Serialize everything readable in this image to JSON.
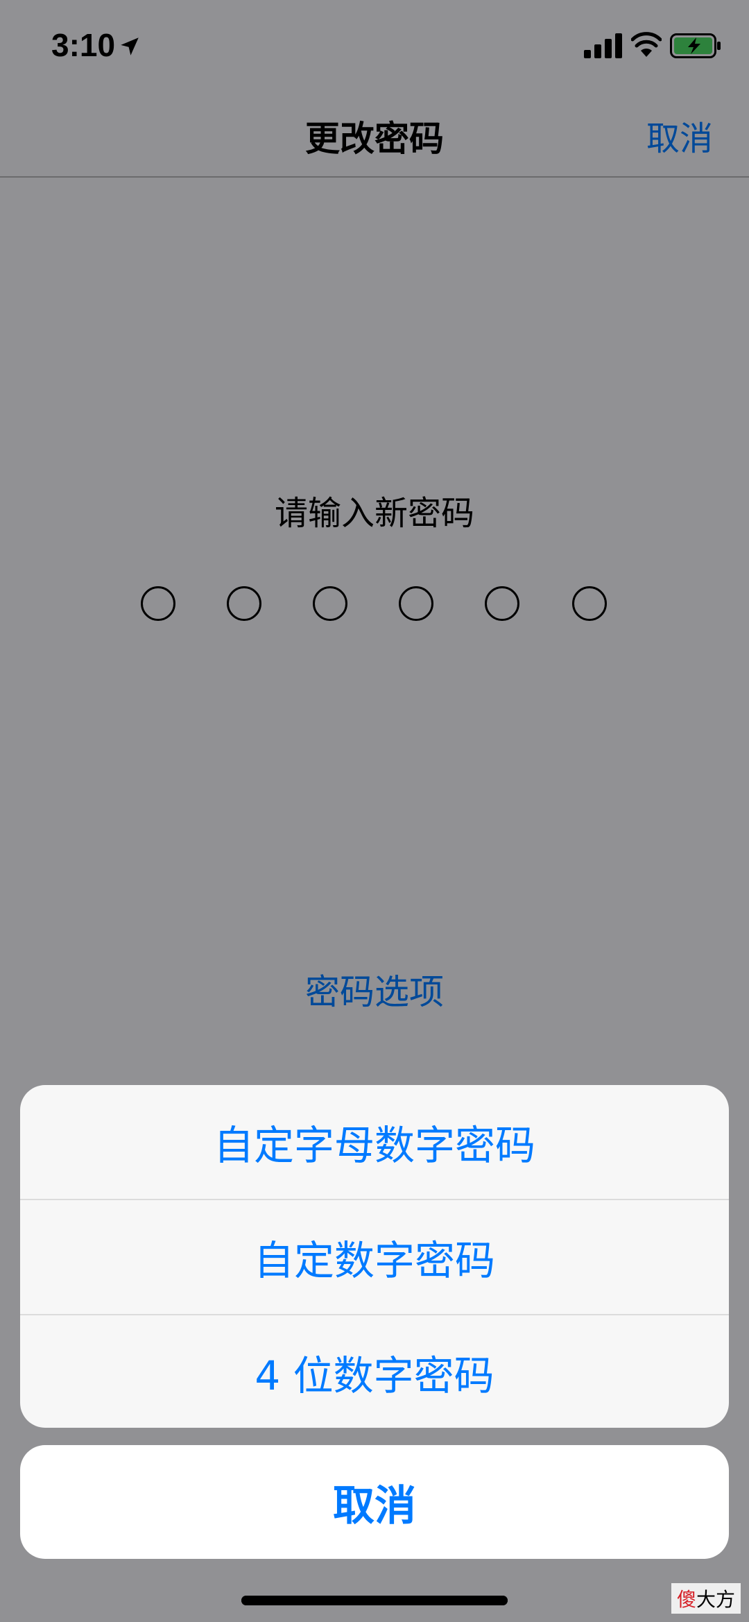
{
  "status_bar": {
    "time": "3:10",
    "icons": [
      "location-arrow-icon",
      "cellular-signal-icon",
      "wifi-icon",
      "battery-charging-icon"
    ]
  },
  "nav": {
    "title": "更改密码",
    "cancel_label": "取消"
  },
  "passcode": {
    "prompt": "请输入新密码",
    "digits": 6
  },
  "options_link": "密码选项",
  "action_sheet": {
    "options": [
      {
        "label": "自定字母数字密码"
      },
      {
        "label": "自定数字密码"
      },
      {
        "label": "4 位数字密码"
      }
    ],
    "cancel_label": "取消"
  },
  "watermark": {
    "accent": "傻",
    "text": "大方"
  },
  "colors": {
    "accent": "#007aff",
    "battery_green": "#4cd964",
    "sheet_background": "#f7f7f7"
  }
}
